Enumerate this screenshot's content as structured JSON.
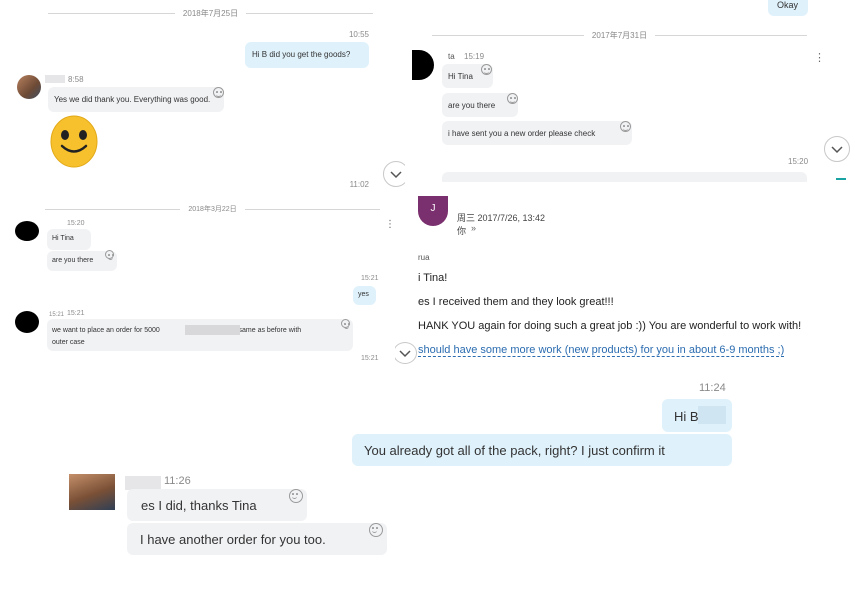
{
  "p1": {
    "date": "2018年7月25日",
    "out_time": "10:55",
    "out_msg": "Hi B   did you get the goods?",
    "in_time": "8:58",
    "in_msg": "Yes we did thank you. Everything was good.",
    "end_time": "11:02"
  },
  "p2": {
    "top_bubble": "Okay",
    "date": "2017年7月31日",
    "sender": "ta",
    "sender_time": "15:19",
    "msgs": [
      "Hi Tina",
      "are you there",
      "i have sent you a new order please check"
    ],
    "end_time": "15:20"
  },
  "p3": {
    "date": "2018年3月22日",
    "t1": "15:20",
    "m1": "Hi Tina",
    "m2": "are you there",
    "out_time": "15:21",
    "out_msg": "yes",
    "in_time_a": "15:21",
    "in_time_b": "15:21",
    "order_line1": "we want to place an order for 5000",
    "order_line1b": "pack same as before with",
    "order_line2": "outer case",
    "end_time": "15:21"
  },
  "p4": {
    "avatar_letter": "J",
    "header": "周三 2017/7/26, 13:42",
    "to": "你",
    "name": "rua",
    "l1": "i Tina!",
    "l2": "es I received them and they look great!!!",
    "l3": "HANK YOU again for doing such a great job :)) You are wonderful to work with!",
    "l4": "should have some more work (new products) for you in about 6-9 months ;)"
  },
  "p5": {
    "out_time": "11:24",
    "out1": "Hi B",
    "out2": "You already got all of the pack, right? I just confirm it",
    "in_time": "11:26",
    "in1": "es I did, thanks Tina",
    "in2": "I have another order for you too."
  },
  "colors": {
    "out_bubble": "#dff1fb",
    "in_bubble": "#f1f2f4",
    "link": "#2b6cb0",
    "avatar_purple": "#7a2f6e"
  }
}
